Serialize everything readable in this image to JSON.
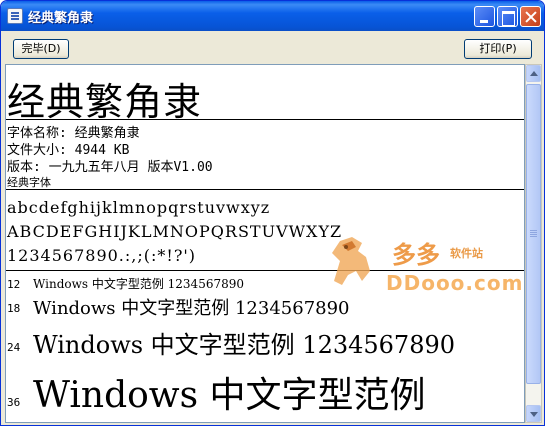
{
  "window": {
    "title": "经典繁角隶"
  },
  "toolbar": {
    "done_label": "完毕(D)",
    "print_label": "打印(P)"
  },
  "preview": {
    "title": "经典繁角隶",
    "info": [
      "字体名称: 经典繁角隶",
      "文件大小: 4944 KB",
      "版本: 一九九五年八月 版本V1.00"
    ],
    "company": "经典字体",
    "lowercase": "abcdefghijklmnopqrstuvwxyz",
    "uppercase": "ABCDEFGHIJKLMNOPQRSTUVWXYZ",
    "digits": "1234567890.:,;(:*!?')",
    "samples": [
      {
        "size": "12",
        "text": "Windows 中文字型范例 1234567890"
      },
      {
        "size": "18",
        "text": "Windows 中文字型范例 1234567890"
      },
      {
        "size": "24",
        "text": "Windows 中文字型范例 1234567890"
      },
      {
        "size": "36",
        "text": "Windows 中文字型范例"
      }
    ]
  },
  "watermark": {
    "brand": "多多",
    "subtitle": "软件站",
    "url": "DDooo.com"
  },
  "colors": {
    "titlebar": "#0a5fe9",
    "watermark": "#ec8a2a"
  }
}
